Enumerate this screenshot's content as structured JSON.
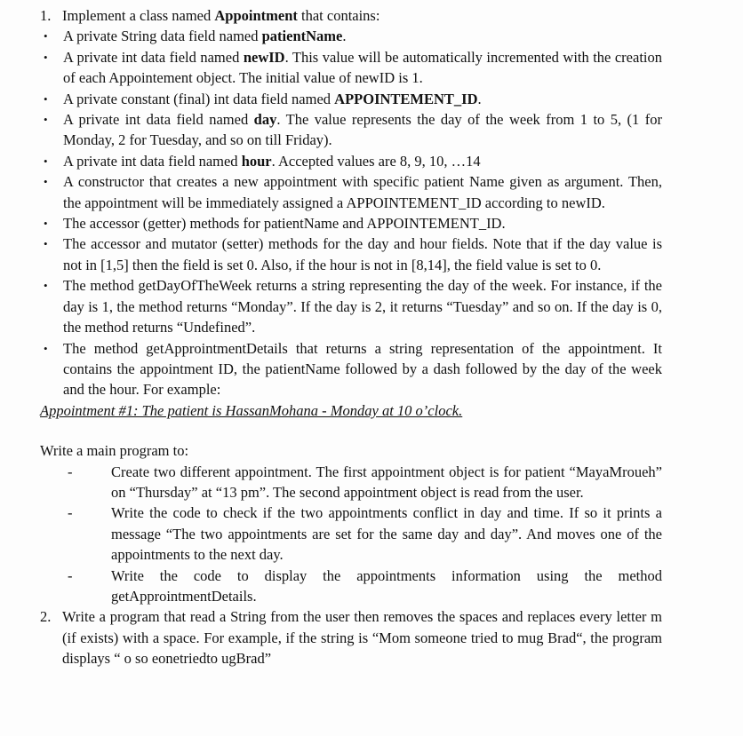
{
  "document": {
    "background_color": "#fdfdfd",
    "text_color": "#121212"
  },
  "markers": {
    "num1": "1.",
    "num2": "2.",
    "bullet": "•",
    "dash": "-"
  },
  "task1": {
    "heading_pre": "Implement a class named ",
    "heading_bold": "Appointment",
    "heading_post": " that contains:",
    "bullets": [
      {
        "parts": [
          {
            "t": "A private String data field named ",
            "b": false
          },
          {
            "t": "patientName",
            "b": true
          },
          {
            "t": ".",
            "b": false
          }
        ]
      },
      {
        "parts": [
          {
            "t": "A private int data field named ",
            "b": false
          },
          {
            "t": "newID",
            "b": true
          },
          {
            "t": ". This value will be automatically incremented with the creation of each Appointement object. The initial value of newID is 1.",
            "b": false
          }
        ]
      },
      {
        "parts": [
          {
            "t": "A private constant (final) int data field named ",
            "b": false
          },
          {
            "t": "APPOINTEMENT_ID",
            "b": true
          },
          {
            "t": ".",
            "b": false
          }
        ]
      },
      {
        "parts": [
          {
            "t": "A private int data field named ",
            "b": false
          },
          {
            "t": "day",
            "b": true
          },
          {
            "t": ". The value represents the day of the week from 1 to 5, (1 for Monday, 2 for Tuesday,  and so on till Friday).",
            "b": false
          }
        ]
      },
      {
        "parts": [
          {
            "t": "A private int data field named ",
            "b": false
          },
          {
            "t": "hour",
            "b": true
          },
          {
            "t": ". Accepted values are 8, 9, 10, …14",
            "b": false
          }
        ]
      },
      {
        "parts": [
          {
            "t": "A constructor that creates a new appointment with specific patient Name given as argument.   Then,   the   appointment   will   be   immediately   assigned   a APPOINTEMENT_ID according to newID.",
            "b": false
          }
        ]
      },
      {
        "parts": [
          {
            "t": "The accessor (getter) methods for patientName and APPOINTEMENT_ID.",
            "b": false
          }
        ]
      },
      {
        "parts": [
          {
            "t": "The accessor and mutator (setter) methods for the day and hour fields. Note that if the day value is not in [1,5] then the field is set 0. Also, if the hour is not in [8,14], the field value is set to 0.",
            "b": false
          }
        ]
      },
      {
        "parts": [
          {
            "t": "The method getDayOfTheWeek returns a string representing the day of the week. For instance, if the day is 1, the method returns “Monday”. If the day is 2, it returns “Tuesday” and so on. If the day is 0, the method returns “Undefined”.",
            "b": false
          }
        ]
      },
      {
        "parts": [
          {
            "t": "The method getApprointmentDetails that returns a string representation of the appointment. It contains the appointment ID, the patientName followed by a dash followed by the day of the week and the hour. For example:",
            "b": false
          }
        ]
      }
    ],
    "example_line": "Appointment #1: The patient is HassanMohana - Monday at 10 o’clock.",
    "main_program_intro": "Write a main program to:",
    "sub_items": [
      "Create two different appointment. The first appointment object is for patient “MayaMroueh” on “Thursday” at “13 pm”. The second appointment object is read from the user.",
      "Write the code to check if the two appointments conflict in day and time. If so it prints a message “The two appointments are set for the same day and day”. And moves one of the appointments to the next day.",
      "Write the code to display the appointments information using the method getApprointmentDetails."
    ]
  },
  "task2": {
    "text": "Write a program that read a String from the user then removes the spaces and replaces every letter m (if exists) with a space. For example, if the string is “Mom someone tried to mug Brad“, the program displays “ o so eonetriedto ugBrad”"
  }
}
